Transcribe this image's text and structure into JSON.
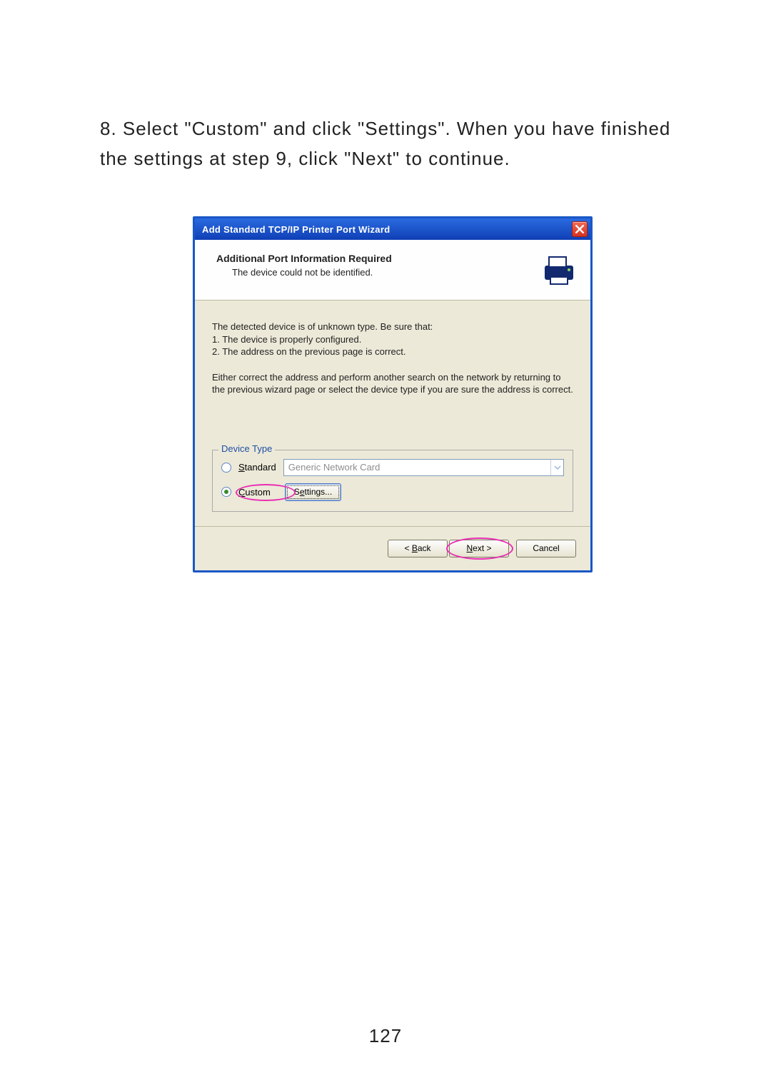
{
  "step_text": "8. Select \"Custom\" and click \"Settings\". When you have finished the settings at step 9, click \"Next\" to continue.",
  "dialog": {
    "title": "Add Standard TCP/IP Printer Port Wizard",
    "header_title": "Additional Port Information Required",
    "header_subtitle": "The device could not be identified.",
    "para1_l1": "The detected device is of unknown type.  Be sure that:",
    "para1_l2": "1.  The device is properly configured.",
    "para1_l3": "2.  The address on the previous page is correct.",
    "para2": "Either correct the address and perform another search on the network by returning to the previous wizard page or select the device type if you are sure the address is correct.",
    "fieldset_label": "Device Type",
    "standard_label_u": "S",
    "standard_label_rest": "tandard",
    "standard_combo": "Generic Network Card",
    "custom_label_u": "C",
    "custom_label_rest": "ustom",
    "settings_label_pre": "S",
    "settings_label_u": "e",
    "settings_label_post": "ttings...",
    "back_pre": "< ",
    "back_u": "B",
    "back_post": "ack",
    "next_u": "N",
    "next_post": "ext >",
    "cancel": "Cancel"
  },
  "page_number": "127"
}
